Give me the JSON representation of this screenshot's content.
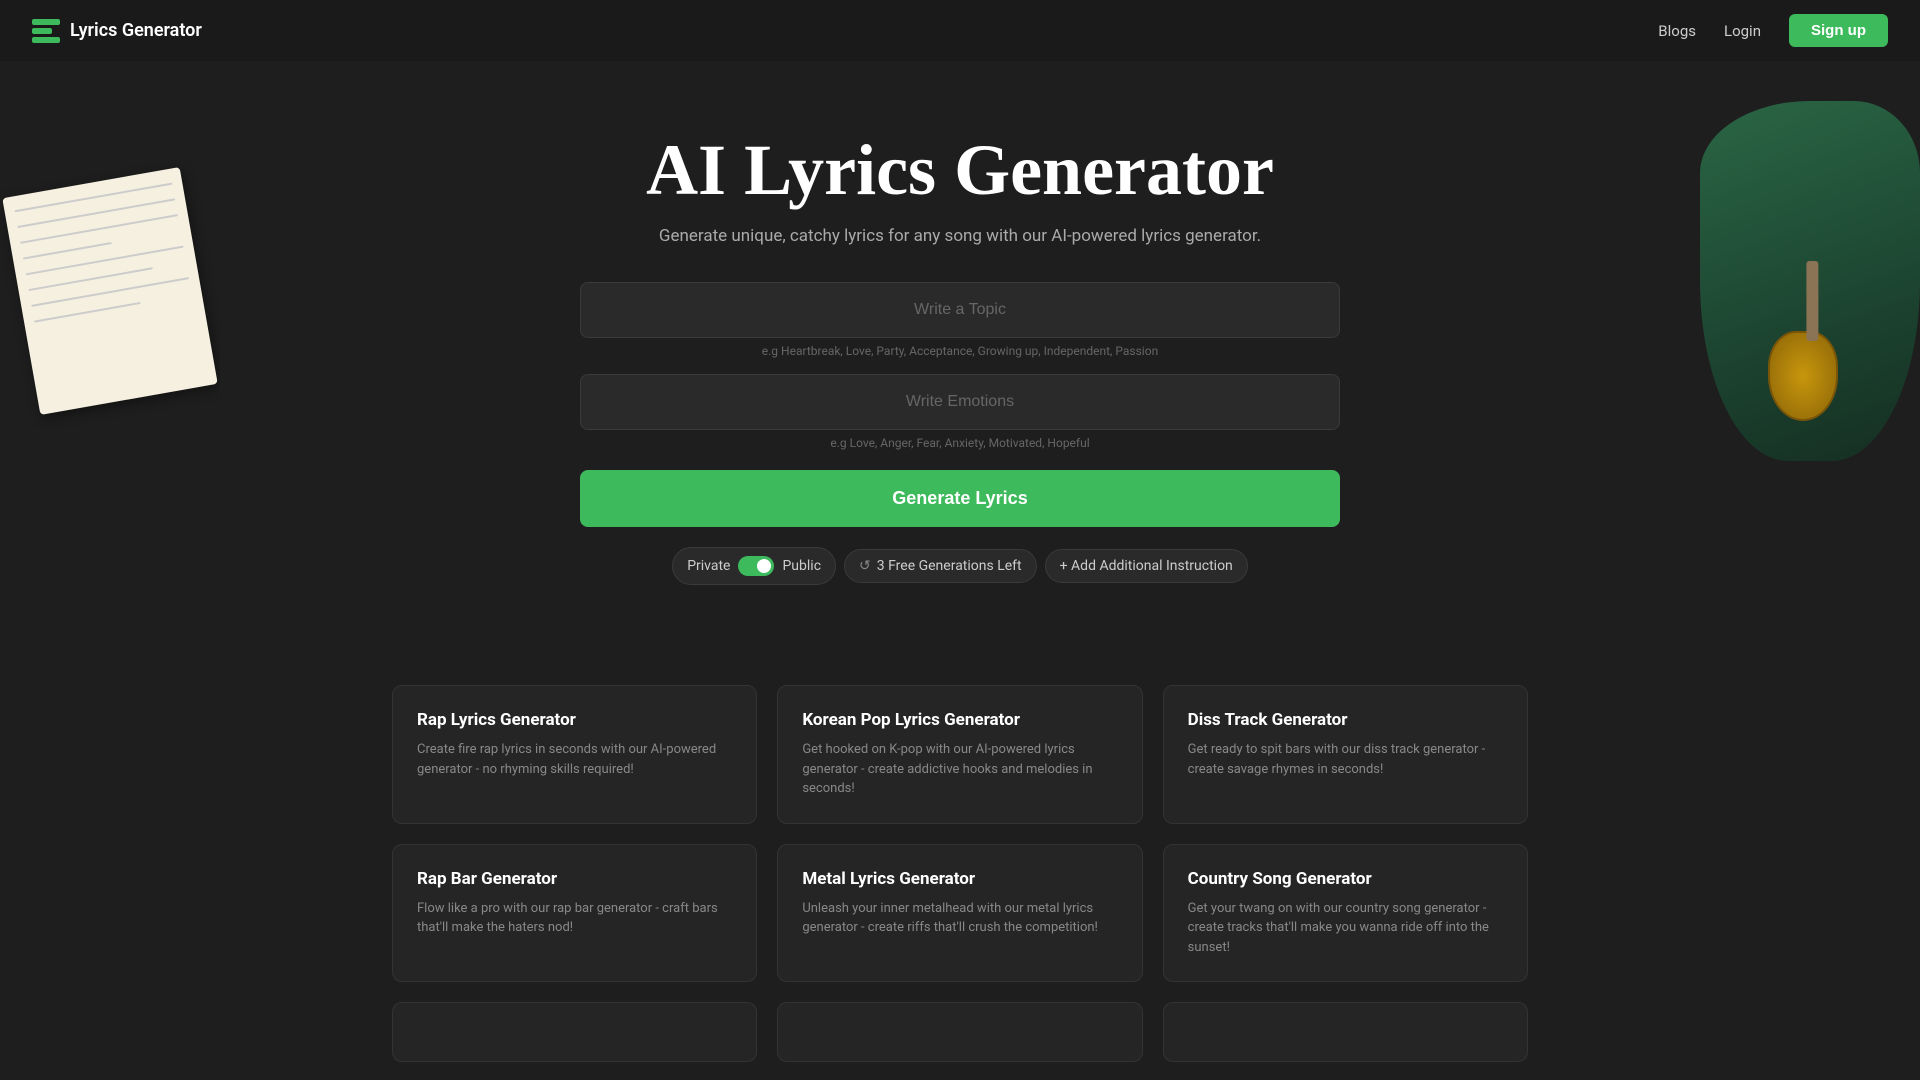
{
  "nav": {
    "brand": "Lyrics Generator",
    "links": [
      {
        "label": "Blogs",
        "name": "nav-blogs"
      },
      {
        "label": "Login",
        "name": "nav-login"
      }
    ],
    "signup_label": "Sign up"
  },
  "hero": {
    "title": "AI Lyrics Generator",
    "subtitle": "Generate unique, catchy lyrics for any song with our AI-powered lyrics generator."
  },
  "form": {
    "topic_placeholder": "Write a Topic",
    "topic_hint": "e.g Heartbreak, Love, Party, Acceptance, Growing up, Independent, Passion",
    "emotions_placeholder": "Write Emotions",
    "emotions_hint": "e.g Love, Anger, Fear, Anxiety, Motivated, Hopeful",
    "generate_label": "Generate Lyrics"
  },
  "controls": {
    "private_label": "Private",
    "public_label": "Public",
    "generations_label": "3 Free Generations Left",
    "add_instruction_label": "+ Add Additional Instruction"
  },
  "cards": [
    {
      "title": "Rap Lyrics Generator",
      "desc": "Create fire rap lyrics in seconds with our AI-powered generator - no rhyming skills required!"
    },
    {
      "title": "Korean Pop Lyrics Generator",
      "desc": "Get hooked on K-pop with our AI-powered lyrics generator - create addictive hooks and melodies in seconds!"
    },
    {
      "title": "Diss Track Generator",
      "desc": "Get ready to spit bars with our diss track generator - create savage rhymes in seconds!"
    },
    {
      "title": "Rap Bar Generator",
      "desc": "Flow like a pro with our rap bar generator - craft bars that'll make the haters nod!"
    },
    {
      "title": "Metal Lyrics Generator",
      "desc": "Unleash your inner metalhead with our metal lyrics generator - create riffs that'll crush the competition!"
    },
    {
      "title": "Country Song Generator",
      "desc": "Get your twang on with our country song generator - create tracks that'll make you wanna ride off into the sunset!"
    }
  ],
  "bottom_cards": [
    {
      "title": ""
    },
    {
      "title": ""
    },
    {
      "title": ""
    }
  ]
}
